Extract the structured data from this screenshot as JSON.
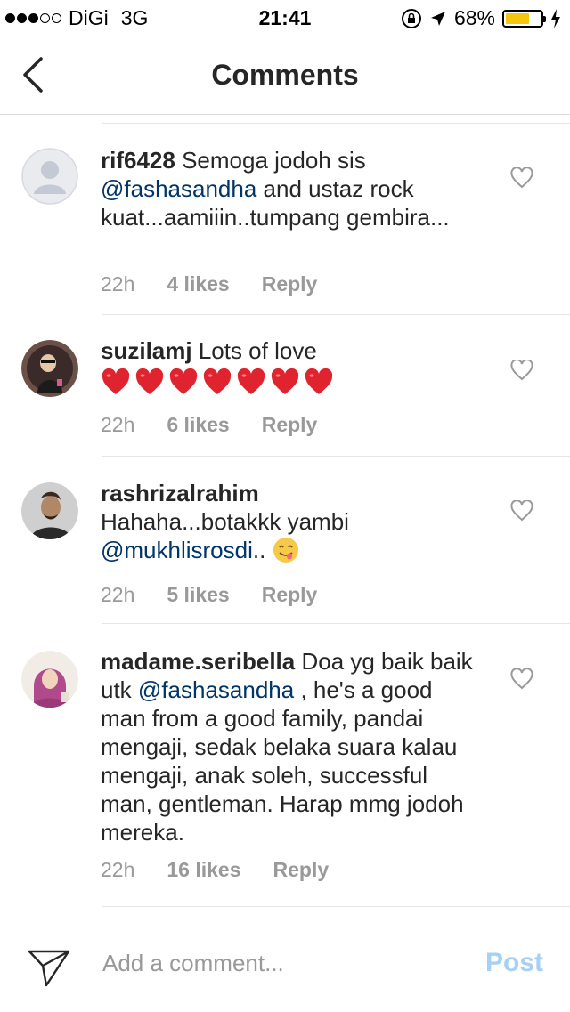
{
  "status_bar": {
    "carrier": "DiGi",
    "network": "3G",
    "time": "21:41",
    "battery": "68%",
    "battery_level": 0.68
  },
  "nav": {
    "title": "Comments"
  },
  "comments": [
    {
      "username": "rif6428",
      "text_before": " Semoga jodoh sis ",
      "mention": "@fashasandha",
      "text_after": "  and ustaz rock kuat...aamiiin..tumpang gembira...",
      "time": "22h",
      "likes": "4 likes",
      "reply": "Reply"
    },
    {
      "username": "suzilamj",
      "text_before": " Lots of love",
      "emoji_hearts": 7,
      "time": "22h",
      "likes": "6 likes",
      "reply": "Reply"
    },
    {
      "username": "rashrizalrahim",
      "text_before": "Hahaha...botakkk yambi ",
      "mention": "@mukhlisrosdi",
      "text_after": "..",
      "time": "22h",
      "likes": "5 likes",
      "reply": "Reply"
    },
    {
      "username": "madame.seribella",
      "text_before": " Doa yg baik baik utk ",
      "mention": "@fashasandha",
      "text_after": " , he's a good man from a good family, pandai mengaji, sedak belaka suara kalau mengaji, anak soleh, successful man, gentleman. Harap mmg jodoh mereka.",
      "time": "22h",
      "likes": "16 likes",
      "reply": "Reply"
    }
  ],
  "composer": {
    "placeholder": "Add a comment...",
    "post_label": "Post"
  },
  "colors": {
    "mention": "#003569",
    "meta": "#999999",
    "post_disabled": "#a7d0f5",
    "battery": "#f5c60e"
  }
}
